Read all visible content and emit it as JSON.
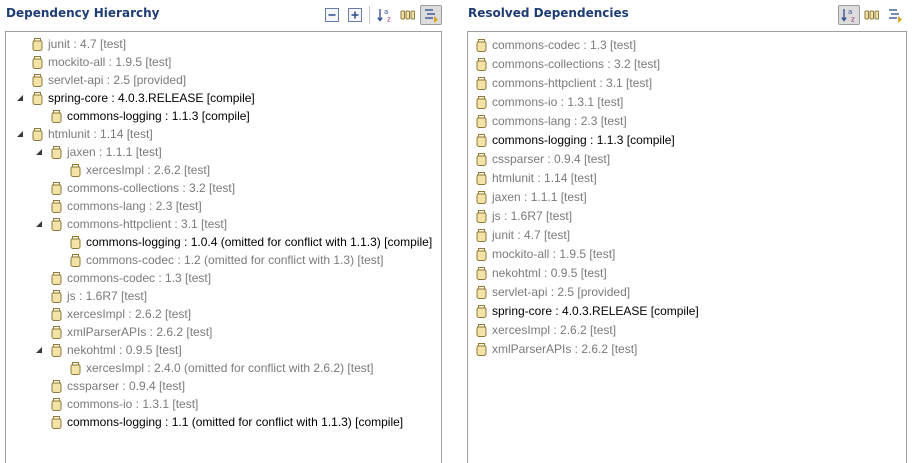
{
  "hierarchy": {
    "title": "Dependency Hierarchy",
    "toolbar": [
      "collapse-all-icon",
      "expand-all-icon",
      "sort-alphabetically-icon",
      "show-group-id-icon",
      "filter-conflicts-icon"
    ],
    "items": [
      {
        "label": "junit : 4.7 [test]",
        "depth": 0,
        "expanded": null,
        "emphasis": false
      },
      {
        "label": "mockito-all : 1.9.5 [test]",
        "depth": 0,
        "expanded": null,
        "emphasis": false
      },
      {
        "label": "servlet-api : 2.5 [provided]",
        "depth": 0,
        "expanded": null,
        "emphasis": false
      },
      {
        "label": "spring-core : 4.0.3.RELEASE [compile]",
        "depth": 0,
        "expanded": true,
        "emphasis": true
      },
      {
        "label": "commons-logging : 1.1.3 [compile]",
        "depth": 1,
        "expanded": null,
        "emphasis": true
      },
      {
        "label": "htmlunit : 1.14 [test]",
        "depth": 0,
        "expanded": true,
        "emphasis": false
      },
      {
        "label": "jaxen : 1.1.1 [test]",
        "depth": 1,
        "expanded": true,
        "emphasis": false
      },
      {
        "label": "xercesImpl : 2.6.2 [test]",
        "depth": 2,
        "expanded": null,
        "emphasis": false
      },
      {
        "label": "commons-collections : 3.2 [test]",
        "depth": 1,
        "expanded": null,
        "emphasis": false
      },
      {
        "label": "commons-lang : 2.3 [test]",
        "depth": 1,
        "expanded": null,
        "emphasis": false
      },
      {
        "label": "commons-httpclient : 3.1 [test]",
        "depth": 1,
        "expanded": true,
        "emphasis": false
      },
      {
        "label": "commons-logging : 1.0.4 (omitted for conflict with 1.1.3) [compile]",
        "depth": 2,
        "expanded": null,
        "emphasis": true
      },
      {
        "label": "commons-codec : 1.2 (omitted for conflict with 1.3) [test]",
        "depth": 2,
        "expanded": null,
        "emphasis": false
      },
      {
        "label": "commons-codec : 1.3 [test]",
        "depth": 1,
        "expanded": null,
        "emphasis": false
      },
      {
        "label": "js : 1.6R7 [test]",
        "depth": 1,
        "expanded": null,
        "emphasis": false
      },
      {
        "label": "xercesImpl : 2.6.2 [test]",
        "depth": 1,
        "expanded": null,
        "emphasis": false
      },
      {
        "label": "xmlParserAPIs : 2.6.2 [test]",
        "depth": 1,
        "expanded": null,
        "emphasis": false
      },
      {
        "label": "nekohtml : 0.9.5 [test]",
        "depth": 1,
        "expanded": true,
        "emphasis": false
      },
      {
        "label": "xercesImpl : 2.4.0 (omitted for conflict with 2.6.2) [test]",
        "depth": 2,
        "expanded": null,
        "emphasis": false
      },
      {
        "label": "cssparser : 0.9.4 [test]",
        "depth": 1,
        "expanded": null,
        "emphasis": false
      },
      {
        "label": "commons-io : 1.3.1 [test]",
        "depth": 1,
        "expanded": null,
        "emphasis": false
      },
      {
        "label": "commons-logging : 1.1 (omitted for conflict with 1.1.3) [compile]",
        "depth": 1,
        "expanded": null,
        "emphasis": true
      }
    ]
  },
  "resolved": {
    "title": "Resolved Dependencies",
    "toolbar": [
      "sort-alphabetically-icon",
      "show-group-id-icon",
      "filter-icon"
    ],
    "items": [
      {
        "label": "commons-codec : 1.3 [test]",
        "emphasis": false
      },
      {
        "label": "commons-collections : 3.2 [test]",
        "emphasis": false
      },
      {
        "label": "commons-httpclient : 3.1 [test]",
        "emphasis": false
      },
      {
        "label": "commons-io : 1.3.1 [test]",
        "emphasis": false
      },
      {
        "label": "commons-lang : 2.3 [test]",
        "emphasis": false
      },
      {
        "label": "commons-logging : 1.1.3 [compile]",
        "emphasis": true
      },
      {
        "label": "cssparser : 0.9.4 [test]",
        "emphasis": false
      },
      {
        "label": "htmlunit : 1.14 [test]",
        "emphasis": false
      },
      {
        "label": "jaxen : 1.1.1 [test]",
        "emphasis": false
      },
      {
        "label": "js : 1.6R7 [test]",
        "emphasis": false
      },
      {
        "label": "junit : 4.7 [test]",
        "emphasis": false
      },
      {
        "label": "mockito-all : 1.9.5 [test]",
        "emphasis": false
      },
      {
        "label": "nekohtml : 0.9.5 [test]",
        "emphasis": false
      },
      {
        "label": "servlet-api : 2.5 [provided]",
        "emphasis": false
      },
      {
        "label": "spring-core : 4.0.3.RELEASE [compile]",
        "emphasis": true
      },
      {
        "label": "xercesImpl : 2.6.2 [test]",
        "emphasis": false
      },
      {
        "label": "xmlParserAPIs : 2.6.2 [test]",
        "emphasis": false
      }
    ]
  },
  "colors": {
    "title": "#1e3d73",
    "dim_text": "#7a7a7a",
    "strong_text": "#000000",
    "jar_fill": "#f3e3a6",
    "jar_stroke": "#8c7a3c"
  }
}
